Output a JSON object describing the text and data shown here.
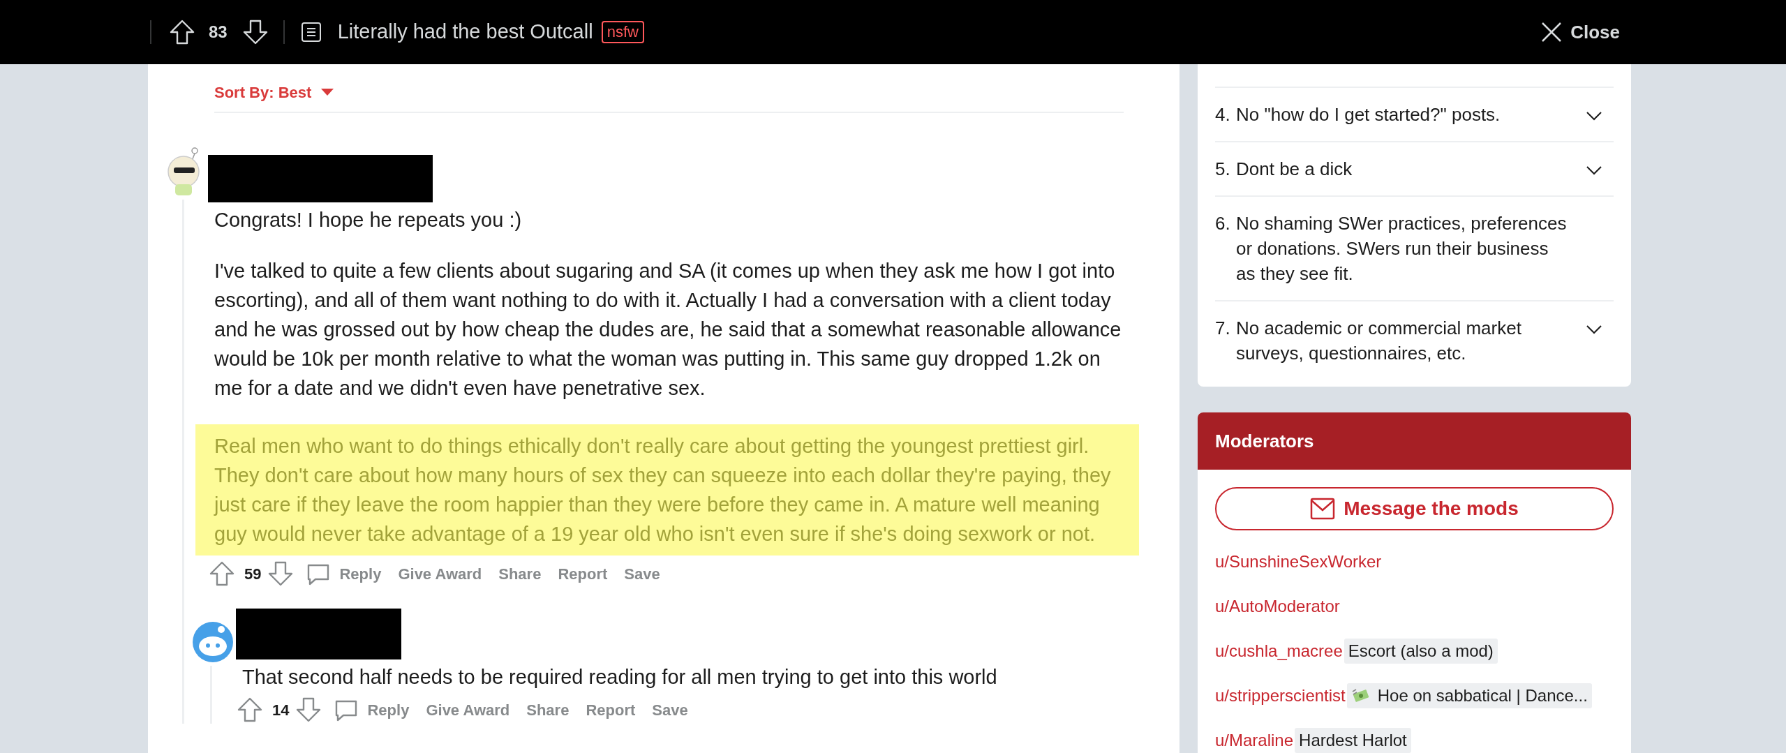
{
  "top_bar": {
    "score": "83",
    "title": "Literally had the best Outcall",
    "tag": "nsfw",
    "close": "Close"
  },
  "sort": {
    "label": "Sort By: Best"
  },
  "comments": [
    {
      "kind": "custom",
      "paragraphs": [
        {
          "text": "Congrats! I hope he repeats you :)",
          "highlighted": false
        },
        {
          "text": "I've talked to quite a few clients about sugaring and SA (it comes up when they ask me how I got into escorting), and all of them want nothing to do with it. Actually I had a conversation with a client today and he was grossed out by how cheap the dudes are, he said that a somewhat reasonable allowance would be 10k per month relative to what the woman was putting in. This same guy dropped 1.2k on me for a date and we didn't even have penetrative sex.",
          "highlighted": false
        },
        {
          "text": "Real men who want to do things ethically don't really care about getting the youngest prettiest girl. They don't care about how many hours of sex they can squeeze into each dollar they're paying, they just care if they leave the room happier than they were before they came in. A mature well meaning guy would never take advantage of a 19 year old who isn't even sure if she's doing sexwork or not.",
          "highlighted": true
        }
      ],
      "score": "59",
      "actions": [
        "Reply",
        "Give Award",
        "Share",
        "Report",
        "Save"
      ],
      "children": [
        {
          "kind": "default",
          "paragraphs": [
            {
              "text": "That second half needs to be required reading for all men trying to get into this world",
              "highlighted": false
            }
          ],
          "score": "14",
          "actions": [
            "Reply",
            "Give Award",
            "Share",
            "Report",
            "Save"
          ]
        }
      ]
    }
  ],
  "rules": [
    {
      "number": "4.",
      "text": "No \"how do I get started?\" posts.",
      "expandable": true
    },
    {
      "number": "5.",
      "text": "Dont be a dick",
      "expandable": true
    },
    {
      "number": "6.",
      "text": "No shaming SWer practices, preferences or donations. SWers run their business as they see fit.",
      "expandable": false
    },
    {
      "number": "7.",
      "text": "No academic or commercial market surveys, questionnaires, etc.",
      "expandable": true
    }
  ],
  "moderators": {
    "title": "Moderators",
    "button": "Message the mods",
    "mods": [
      {
        "name": "u/SunshineSexWorker"
      },
      {
        "name": "u/AutoModerator"
      },
      {
        "name": "u/cushla_macree",
        "flair": "Escort (also a mod)"
      },
      {
        "name": "u/stripperscientist",
        "flair": "Hoe on sabbatical | Dance...",
        "flair_icon": true
      },
      {
        "name": "u/Maraline",
        "flair": "Hardest Harlot"
      }
    ]
  }
}
